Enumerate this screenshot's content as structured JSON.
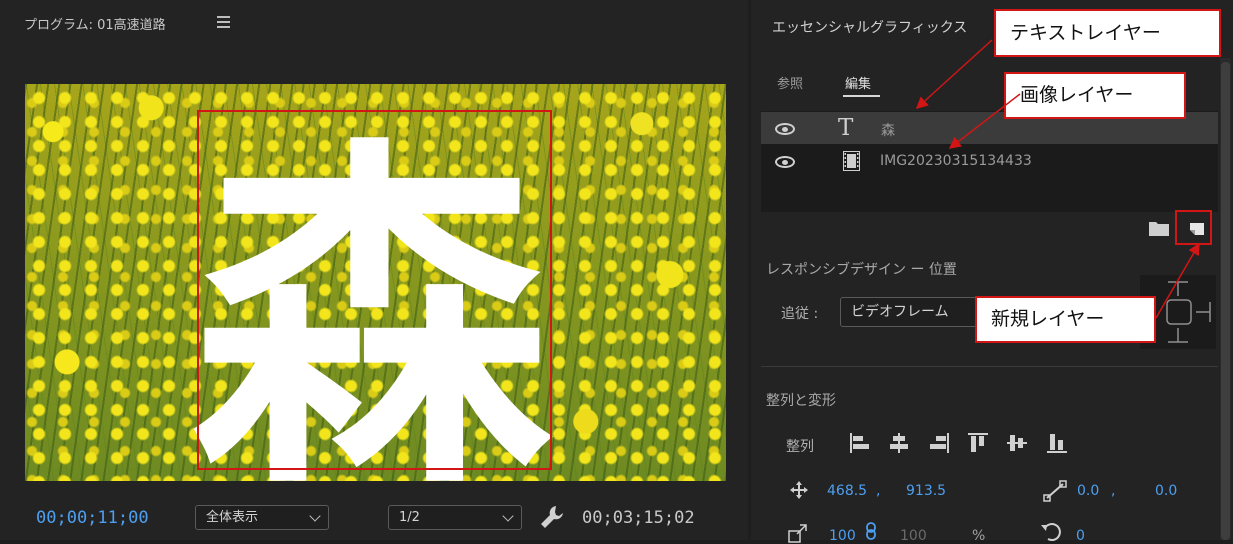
{
  "program_monitor": {
    "title": "プログラム: 01高速道路",
    "overlay_text": "森",
    "current_time": "00;00;11;00",
    "fit_value": "全体表示",
    "resolution_value": "1/2",
    "duration": "00;03;15;02"
  },
  "essential_graphics": {
    "title": "エッセンシャルグラフィックス",
    "tabs": [
      {
        "label": "参照",
        "active": false
      },
      {
        "label": "編集",
        "active": true
      }
    ],
    "layers": [
      {
        "name": "森",
        "type": "text-icon",
        "selected": true
      },
      {
        "name": "IMG20230315134433",
        "type": "film-icon",
        "selected": false
      }
    ],
    "responsive_title": "レスポンシブデザイン ー 位置",
    "follow_label": "追従 :",
    "follow_value": "ビデオフレーム",
    "align_section_title": "整列と変形",
    "align_label": "整列",
    "position_x": "468.5",
    "position_y": "913.5",
    "anchor_x": "0.0",
    "anchor_y": "0.0",
    "scale": "100",
    "scale_width": "100",
    "percent_sign": "%",
    "rotation": "0",
    "comma": ","
  },
  "callouts": {
    "text_layer": "テキストレイヤー",
    "image_layer": "画像レイヤー",
    "new_layer": "新規レイヤー"
  },
  "colors": {
    "accent_blue": "#4d9ff0",
    "annotation_red": "#d21515",
    "panel_bg": "#232323"
  }
}
